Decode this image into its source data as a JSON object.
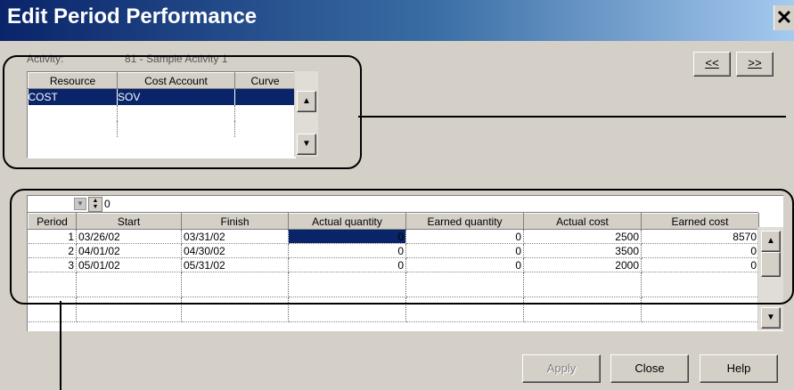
{
  "window": {
    "title": "Edit Period Performance",
    "close_glyph": "✕"
  },
  "activity": {
    "label": "Activity:",
    "value": "81 - Sample Activity 1"
  },
  "nav": {
    "prev_label": "<<",
    "next_label": ">>"
  },
  "resource_grid": {
    "columns": [
      "Resource",
      "Cost Account",
      "Curve"
    ],
    "rows": [
      {
        "resource": "COST",
        "cost_account": "SOV",
        "curve": ""
      }
    ]
  },
  "edit_bar": {
    "value": "0"
  },
  "period_grid": {
    "columns": [
      "Period",
      "Start",
      "Finish",
      "Actual quantity",
      "Earned quantity",
      "Actual cost",
      "Earned cost"
    ],
    "rows": [
      {
        "period": "1",
        "start": "03/26/02",
        "finish": "03/31/02",
        "actual_quantity": "0",
        "earned_quantity": "0",
        "actual_cost": "2500",
        "earned_cost": "8570"
      },
      {
        "period": "2",
        "start": "04/01/02",
        "finish": "04/30/02",
        "actual_quantity": "0",
        "earned_quantity": "0",
        "actual_cost": "3500",
        "earned_cost": "0"
      },
      {
        "period": "3",
        "start": "05/01/02",
        "finish": "05/31/02",
        "actual_quantity": "0",
        "earned_quantity": "0",
        "actual_cost": "2000",
        "earned_cost": "0"
      }
    ]
  },
  "buttons": {
    "apply": "Apply",
    "close": "Close",
    "help": "Help"
  },
  "icons": {
    "scroll_up": "scroll-up-icon",
    "scroll_down": "scroll-down-icon",
    "dropdown": "dropdown-icon",
    "spin": "spin-icon"
  }
}
